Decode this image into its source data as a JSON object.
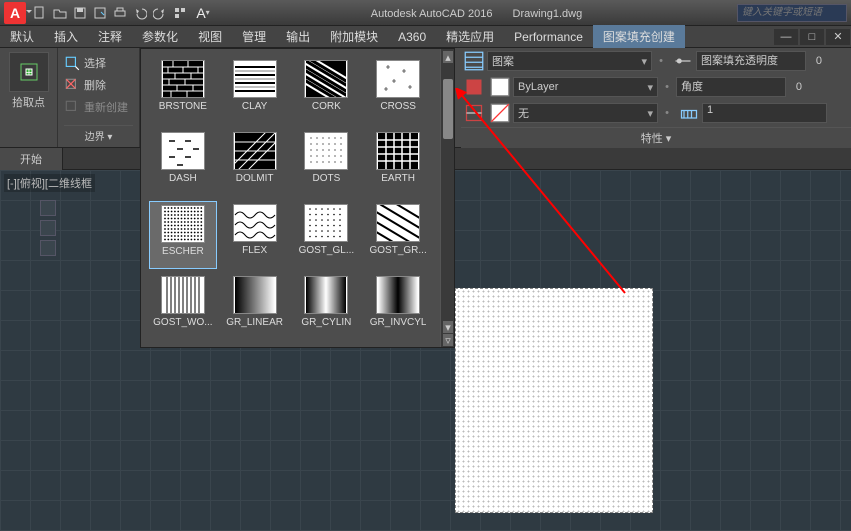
{
  "app": {
    "title": "Autodesk AutoCAD 2016",
    "document": "Drawing1.dwg",
    "search_placeholder": "键入关键字或短语"
  },
  "menu": {
    "items": [
      "默认",
      "插入",
      "注释",
      "参数化",
      "视图",
      "管理",
      "输出",
      "附加模块",
      "A360",
      "精选应用",
      "Performance",
      "图案填充创建"
    ],
    "active": 11
  },
  "ribbon_left": {
    "pick_label": "拾取点",
    "panel_label": "边界 ▾",
    "select": "选择",
    "delete": "删除",
    "recreate": "重新创建"
  },
  "patterns": [
    {
      "name": "BRSTONE",
      "type": "brstone"
    },
    {
      "name": "CLAY",
      "type": "clay"
    },
    {
      "name": "CORK",
      "type": "cork"
    },
    {
      "name": "CROSS",
      "type": "cross"
    },
    {
      "name": "DASH",
      "type": "dash"
    },
    {
      "name": "DOLMIT",
      "type": "dolmit"
    },
    {
      "name": "DOTS",
      "type": "dots"
    },
    {
      "name": "EARTH",
      "type": "earth"
    },
    {
      "name": "ESCHER",
      "type": "escher",
      "selected": true
    },
    {
      "name": "FLEX",
      "type": "flex"
    },
    {
      "name": "GOST_GL...",
      "type": "gost_gl"
    },
    {
      "name": "GOST_GR...",
      "type": "gost_gr"
    },
    {
      "name": "GOST_WO...",
      "type": "gost_wo"
    },
    {
      "name": "GR_LINEAR",
      "type": "gr_linear"
    },
    {
      "name": "GR_CYLIN",
      "type": "gr_cylin"
    },
    {
      "name": "GR_INVCYL",
      "type": "gr_invcyl"
    }
  ],
  "props": {
    "panel_label": "特性 ▾",
    "row1": {
      "type": "图案",
      "transparency_label": "图案填充透明度",
      "transparency_val": "0"
    },
    "row2": {
      "layer": "ByLayer",
      "angle_label": "角度",
      "angle_val": "0"
    },
    "row3": {
      "none": "无",
      "scale_val": "1"
    }
  },
  "start": {
    "tab": "开始"
  },
  "viewport": {
    "label": "[-][俯视][二维线框"
  }
}
